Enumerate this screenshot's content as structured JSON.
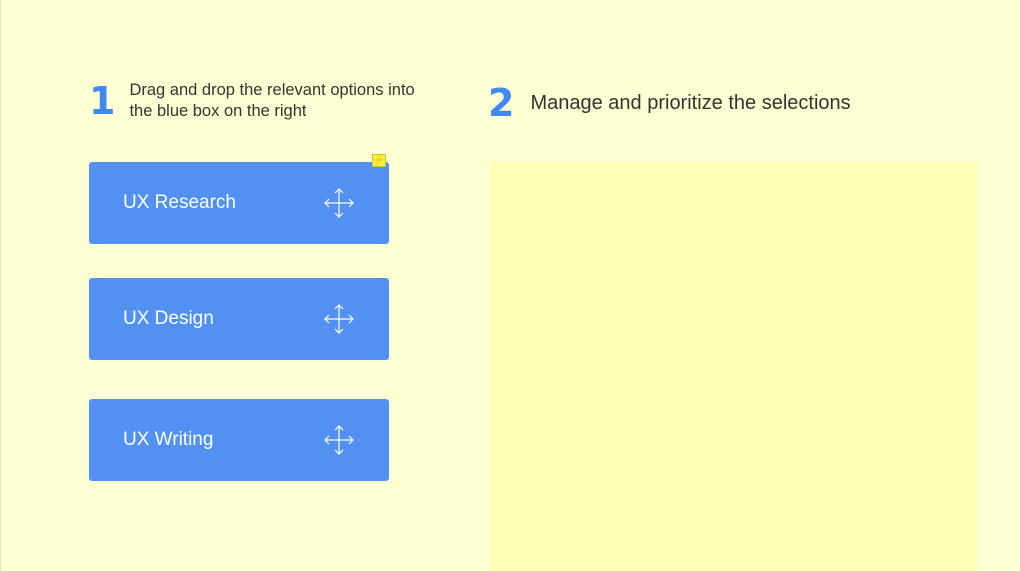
{
  "step1": {
    "number": "1",
    "instruction": "Drag and drop the relevant options into the blue box on the right"
  },
  "step2": {
    "number": "2",
    "instruction": "Manage and prioritize the selections"
  },
  "options": [
    {
      "label": "UX Research",
      "icon": "move-icon"
    },
    {
      "label": "UX Design",
      "icon": "move-icon"
    },
    {
      "label": "UX Writing",
      "icon": "move-icon"
    }
  ],
  "badge": {
    "icon": "lightning-icon",
    "glyph": "⚡"
  },
  "colors": {
    "background": "#FFFFD4",
    "accent": "#3F8AF2",
    "card": "#5291F2",
    "drop_zone": "#FFFFB8",
    "badge": "#F2F23A"
  }
}
